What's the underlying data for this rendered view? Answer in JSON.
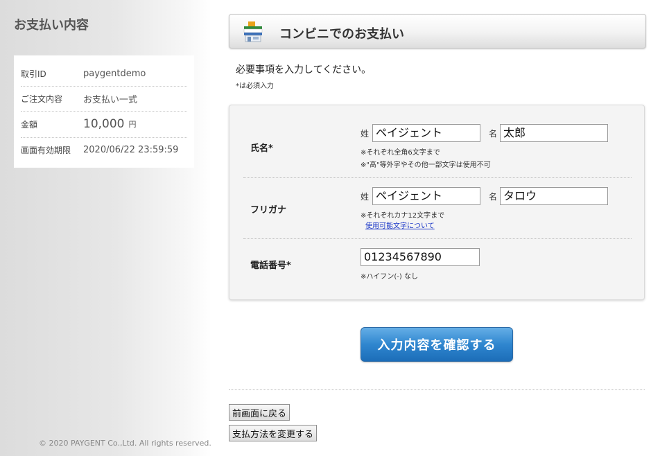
{
  "sidebar": {
    "title": "お支払い内容",
    "summary": {
      "transaction_id_label": "取引ID",
      "transaction_id": "paygentdemo",
      "order_label": "ご注文内容",
      "order": "お支払い一式",
      "amount_label": "金額",
      "amount": "10,000",
      "amount_unit": "円",
      "expiry_label": "画面有効期限",
      "expiry": "2020/06/22 23:59:59"
    },
    "copyright": "© 2020 PAYGENT Co.,Ltd. All rights reserved."
  },
  "header": {
    "title": "コンビニでのお支払い",
    "icon": "convenience-store-icon",
    "icon_colors": {
      "roof": "#e8a21a",
      "stripe": "#2f8a3a",
      "body": "#3a6fb8"
    }
  },
  "instruction": "必要事項を入力してください。",
  "required_note": "*は必須入力",
  "form": {
    "name": {
      "label": "氏名*",
      "last_label": "姓",
      "last_value": "ペイジェント",
      "first_label": "名",
      "first_value": "太郎",
      "note1": "※それぞれ全角6文字まで",
      "note2": "※\"高\"等外字やその他一部文字は使用不可"
    },
    "kana": {
      "label": "フリガナ",
      "last_label": "姓",
      "last_value": "ペイジェント",
      "first_label": "名",
      "first_value": "タロウ",
      "note": "※それぞれカナ12文字まで",
      "link": "使用可能文字について"
    },
    "phone": {
      "label": "電話番号*",
      "value": "01234567890",
      "note": "※ハイフン(-) なし"
    }
  },
  "buttons": {
    "submit": "入力内容を確認する",
    "back": "前画面に戻る",
    "change_method": "支払方法を変更する"
  },
  "colors": {
    "submit_button": "#2f86cf",
    "link": "#1a36c7"
  }
}
